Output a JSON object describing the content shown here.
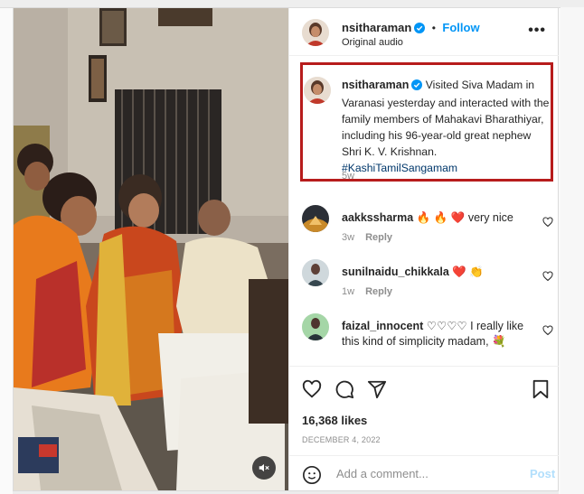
{
  "post": {
    "username": "nsitharaman",
    "follow_label": "Follow",
    "separator": "•",
    "audio": "Original audio",
    "more_icon": "more-horizontal-icon",
    "caption": {
      "username": "nsitharaman",
      "text": "Visited Siva Madam in Varanasi yesterday and interacted with the family members of Mahakavi Bharathiyar, including his 96-year-old great nephew Shri K. V. Krishnan.",
      "hashtag": "#KashiTamilSangamam",
      "time": "5w",
      "highlight_color": "#b71c1c"
    },
    "comments": [
      {
        "username": "aakkssharma",
        "text": "very nice",
        "emoji": "🔥 🔥 ❤️",
        "time": "3w",
        "reply": "Reply"
      },
      {
        "username": "sunilnaidu_chikkala",
        "text": "",
        "emoji": "❤️ 👏",
        "time": "1w",
        "reply": "Reply"
      },
      {
        "username": "faizal_innocent",
        "text": "♡♡♡♡ I really like this kind of simplicity madam,",
        "emoji": "💐",
        "time": "",
        "reply": ""
      }
    ],
    "likes": "16,368 likes",
    "date": "DECEMBER 4, 2022",
    "add_comment_placeholder": "Add a comment...",
    "post_button": "Post",
    "colors": {
      "link": "#0095f6",
      "post_disabled": "#b2dffc",
      "hashtag": "#00376b"
    }
  }
}
